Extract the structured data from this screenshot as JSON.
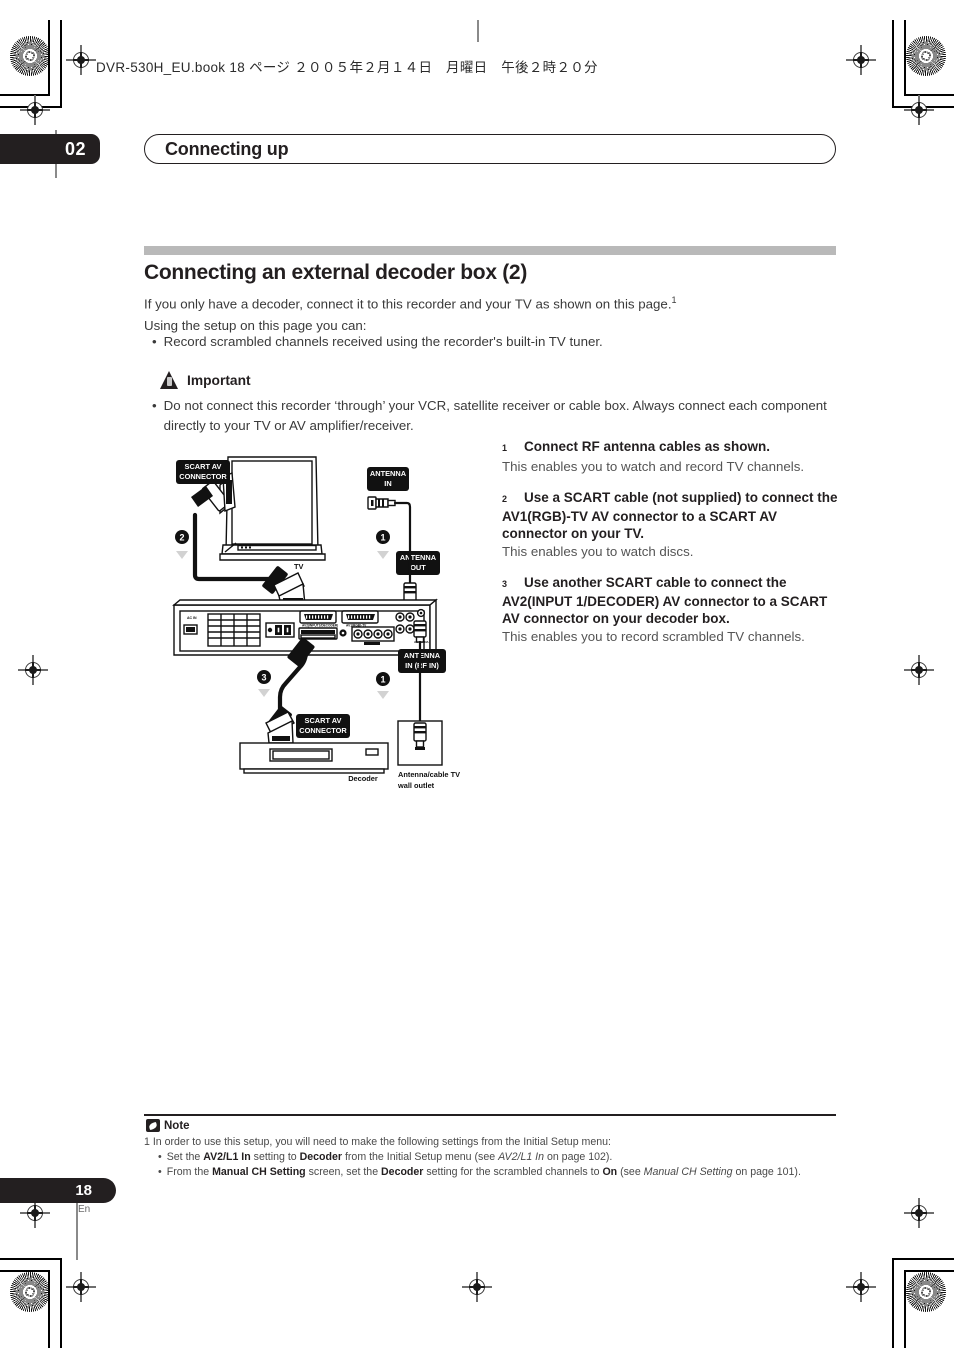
{
  "print_header": "DVR-530H_EU.book   18 ページ   ２００５年２月１４日　月曜日　午後２時２０分",
  "chapter": {
    "number": "02",
    "title": "Connecting up"
  },
  "section": {
    "title": "Connecting an external decoder box (2)",
    "intro_line1": "If you only have a decoder, connect it to this recorder and your TV as shown on this page.",
    "intro_footnote_marker": "1",
    "intro_line2": "Using the setup on this page you can:",
    "bullets": [
      "Record scrambled channels received using the recorder's built-in TV tuner."
    ]
  },
  "important": {
    "icon": "warning-triangle-icon",
    "label": "Important",
    "bullets": [
      "Do not connect this recorder ‘through’ your VCR, satellite receiver or cable box. Always connect each component directly to your TV or AV amplifier/receiver."
    ]
  },
  "steps": [
    {
      "number": "1",
      "heading": "Connect RF antenna cables as shown.",
      "detail": "This enables you to watch and record TV channels."
    },
    {
      "number": "2",
      "heading": "Use a SCART cable (not supplied) to connect the AV1(RGB)-TV AV connector to a SCART AV connector on your TV.",
      "detail": "This enables you to watch discs."
    },
    {
      "number": "3",
      "heading": "Use another SCART cable to connect the AV2(INPUT 1/DECODER) AV connector to a SCART AV connector on your decoder box.",
      "detail": "This enables you to record scrambled TV channels."
    }
  ],
  "diagram": {
    "labels": {
      "scart_tv": "SCART AV\nCONNECTOR",
      "scart_tv_l1": "SCART AV",
      "scart_tv_l2": "CONNECTOR",
      "antenna_in_l1": "ANTENNA",
      "antenna_in_l2": "IN",
      "antenna_out_l1": "ANTENNA",
      "antenna_out_l2": "OUT",
      "antenna_rf_in_l1": "ANTENNA",
      "antenna_rf_in_l2": "IN (RF IN)",
      "scart_dec_l1": "SCART AV",
      "scart_dec_l2": "CONNECTOR",
      "tv": "TV",
      "decoder": "Decoder",
      "wall_outlet_l1": "Antenna/cable TV",
      "wall_outlet_l2": "wall outlet"
    },
    "callouts": [
      "1",
      "2",
      "3"
    ]
  },
  "note": {
    "icon": "note-icon",
    "label": "Note",
    "intro": "1 In order to use this setup, you will need to make the following settings from the Initial Setup menu:",
    "items": [
      {
        "pre": "Set the ",
        "b1": "AV2/L1 In",
        "mid1": " setting to ",
        "b2": "Decoder",
        "mid2": " from the Initial Setup menu (see ",
        "i1": "AV2/L1 In",
        "post": " on page 102)."
      },
      {
        "pre": "From the ",
        "b1": "Manual CH Setting",
        "mid1": " screen, set the ",
        "b2": "Decoder",
        "mid2": " setting for the scrambled channels to ",
        "b3": "On",
        "mid3": " (see ",
        "i1": "Manual CH Setting",
        "post": " on page 101)."
      }
    ]
  },
  "footer": {
    "page": "18",
    "lang": "En"
  },
  "colors": {
    "ink": "#231f20",
    "gray_rule": "#b9b9b9",
    "body_text": "#3a3a3a",
    "muted": "#6a6a6a"
  }
}
